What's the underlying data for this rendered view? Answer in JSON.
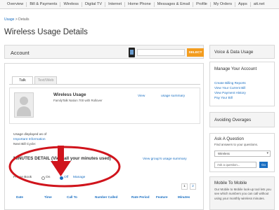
{
  "nav": {
    "items": [
      "Overview",
      "Bill & Payments",
      "Wireless",
      "Digital TV",
      "Internet",
      "Home Phone",
      "Messages & Email",
      "Profile",
      "My Orders",
      "Apps",
      "att.net"
    ]
  },
  "breadcrumb": {
    "link": "Usage",
    "separator": " > ",
    "current": "Details"
  },
  "page_title": "Wireless Usage Details",
  "account": {
    "label": "Account",
    "select_button": "SELECT"
  },
  "tabs": [
    "Talk",
    "Text/Web"
  ],
  "usage": {
    "title": "Wireless Usage",
    "plan": "FamilyTalk Nation 700 with Rollover",
    "view_link": "View",
    "summary_link": "usage summary"
  },
  "info": {
    "as_of": "Usage displayed as of",
    "important": "Important Information",
    "bill_cycle": "Next Bill Cycle:"
  },
  "minutes": {
    "title": "MINUTES DETAIL (View all your minutes used)",
    "group_link": "View group's usage summary"
  },
  "phone_book": {
    "label": "Phone Book",
    "on": "On",
    "off": "Off",
    "manage": "Manage"
  },
  "pagination": [
    "1",
    "2"
  ],
  "columns": [
    "Date",
    "Time",
    "Call To",
    "Number Called",
    "Rate Period",
    "Feature",
    "Minutes"
  ],
  "sidebar": {
    "voice_data": "Voice & Data Usage",
    "manage_title": "Manage Your Account",
    "links": [
      "Create Billing Reports",
      "View Your Current Bill",
      "View Payment History",
      "Pay Your Bill"
    ],
    "avoiding": "Avoiding Overages",
    "ask_title": "Ask A Question",
    "ask_text": "Find answers to your questions.",
    "select_value": "Wireless",
    "input_placeholder": "Ask a question...",
    "go": "Go",
    "mobile_title": "Mobile To Mobile",
    "mobile_text": "Our Mobile to Mobile look-up tool lets you see which numbers you can call without using your monthly wireless minutes."
  },
  "colors": {
    "link": "#1a6fc2",
    "accent_button": "#f39c1e",
    "annotation": "#d0141c"
  }
}
